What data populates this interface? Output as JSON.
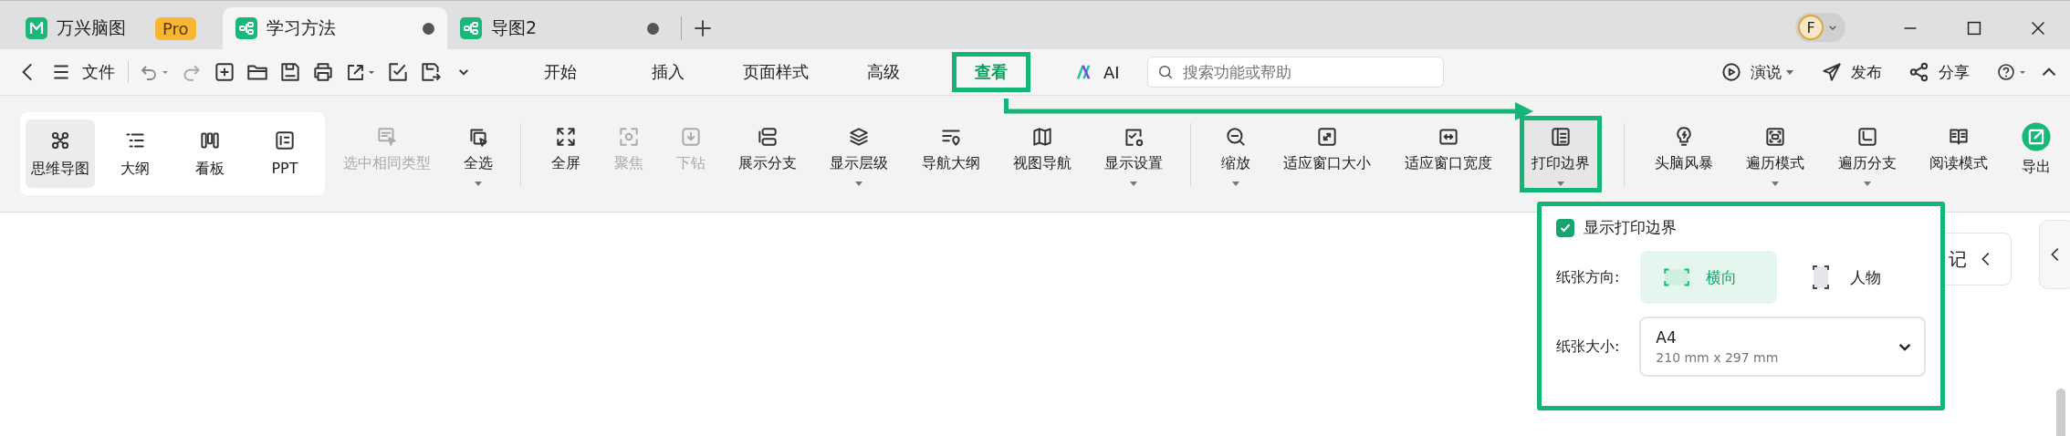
{
  "tabs": [
    {
      "kind": "app",
      "label": "万兴脑图",
      "badge": "Pro",
      "selected": false
    },
    {
      "kind": "doc",
      "label": "学习方法",
      "selected": true
    },
    {
      "kind": "doc",
      "label": "导图2",
      "selected": false
    }
  ],
  "avatar": "F",
  "menu": {
    "file": "文件",
    "tabs": [
      {
        "label": "开始",
        "selected": false,
        "highlighted": false
      },
      {
        "label": "插入",
        "selected": false,
        "highlighted": false
      },
      {
        "label": "页面样式",
        "selected": false,
        "highlighted": false
      },
      {
        "label": "高级",
        "selected": false,
        "highlighted": false
      },
      {
        "label": "查看",
        "selected": true,
        "highlighted": true
      }
    ],
    "ai": "AI",
    "search": {
      "placeholder": "搜索功能或帮助"
    },
    "actions": [
      {
        "kind": "play",
        "label": "演说",
        "dropdown": true
      },
      {
        "kind": "send",
        "label": "发布",
        "dropdown": false
      },
      {
        "kind": "share",
        "label": "分享",
        "dropdown": false
      }
    ]
  },
  "ribbon": {
    "views": [
      {
        "kind": "mindmap",
        "label": "思维导图",
        "selected": true
      },
      {
        "kind": "outline",
        "label": "大纲",
        "selected": false
      },
      {
        "kind": "board",
        "label": "看板",
        "selected": false
      },
      {
        "kind": "ppt",
        "label": "PPT",
        "selected": false
      }
    ],
    "tools": [
      {
        "kind": "select-same",
        "label": "选中相同类型",
        "disabled": true,
        "dropdown": false,
        "selected": false,
        "highlighted": false,
        "divider_before": false
      },
      {
        "kind": "select-all",
        "label": "全选",
        "disabled": false,
        "dropdown": true,
        "selected": false,
        "highlighted": false,
        "divider_before": false
      },
      {
        "kind": "fullscreen",
        "label": "全屏",
        "disabled": false,
        "dropdown": false,
        "selected": false,
        "highlighted": false,
        "divider_before": true
      },
      {
        "kind": "focus",
        "label": "聚焦",
        "disabled": true,
        "dropdown": false,
        "selected": false,
        "highlighted": false,
        "divider_before": false
      },
      {
        "kind": "drill",
        "label": "下钻",
        "disabled": true,
        "dropdown": false,
        "selected": false,
        "highlighted": false,
        "divider_before": false
      },
      {
        "kind": "branches",
        "label": "展示分支",
        "disabled": false,
        "dropdown": false,
        "selected": false,
        "highlighted": false,
        "divider_before": false
      },
      {
        "kind": "layers",
        "label": "显示层级",
        "disabled": false,
        "dropdown": true,
        "selected": false,
        "highlighted": false,
        "divider_before": false
      },
      {
        "kind": "nav-outline",
        "label": "导航大纲",
        "disabled": false,
        "dropdown": false,
        "selected": false,
        "highlighted": false,
        "divider_before": false
      },
      {
        "kind": "map",
        "label": "视图导航",
        "disabled": false,
        "dropdown": false,
        "selected": false,
        "highlighted": false,
        "divider_before": false
      },
      {
        "kind": "settings",
        "label": "显示设置",
        "disabled": false,
        "dropdown": true,
        "selected": false,
        "highlighted": false,
        "divider_before": false
      },
      {
        "kind": "zoom",
        "label": "缩放",
        "disabled": false,
        "dropdown": true,
        "selected": false,
        "highlighted": false,
        "divider_before": true
      },
      {
        "kind": "fit-size",
        "label": "适应窗口大小",
        "disabled": false,
        "dropdown": false,
        "selected": false,
        "highlighted": false,
        "divider_before": false
      },
      {
        "kind": "fit-width",
        "label": "适应窗口宽度",
        "disabled": false,
        "dropdown": false,
        "selected": false,
        "highlighted": false,
        "divider_before": false
      },
      {
        "kind": "print",
        "label": "打印边界",
        "disabled": false,
        "dropdown": true,
        "selected": true,
        "highlighted": true,
        "divider_before": false
      },
      {
        "kind": "bulb",
        "label": "头脑风暴",
        "disabled": false,
        "dropdown": false,
        "selected": false,
        "highlighted": false,
        "divider_before": true
      },
      {
        "kind": "traverse",
        "label": "遍历模式",
        "disabled": false,
        "dropdown": true,
        "selected": false,
        "highlighted": false,
        "divider_before": false
      },
      {
        "kind": "traverse-branch",
        "label": "遍历分支",
        "disabled": false,
        "dropdown": true,
        "selected": false,
        "highlighted": false,
        "divider_before": false
      },
      {
        "kind": "book",
        "label": "阅读模式",
        "disabled": false,
        "dropdown": false,
        "selected": false,
        "highlighted": false,
        "divider_before": false
      },
      {
        "kind": "export",
        "label": "导出",
        "disabled": false,
        "dropdown": false,
        "selected": false,
        "highlighted": false,
        "divider_before": false
      }
    ]
  },
  "popup": {
    "show_border": {
      "label": "显示打印边界",
      "checked": true
    },
    "orientation": {
      "label": "纸张方向:",
      "options": [
        {
          "kind": "landscape",
          "label": "横向",
          "selected": true
        },
        {
          "kind": "portrait",
          "label": "人物",
          "selected": false
        }
      ]
    },
    "size": {
      "label": "纸张大小:",
      "value": "A4",
      "detail": "210 mm x 297 mm"
    }
  },
  "side_button": "记"
}
